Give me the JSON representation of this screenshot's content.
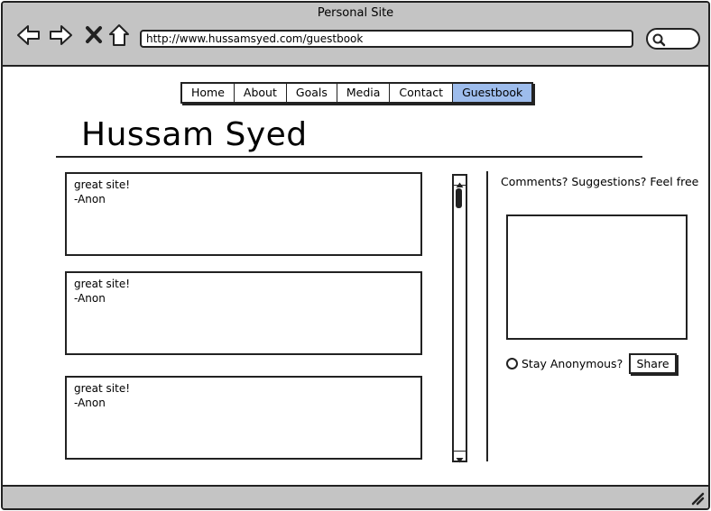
{
  "window": {
    "title": "Personal Site"
  },
  "browser": {
    "url": "http://www.hussamsyed.com/guestbook",
    "icons": [
      "back-arrow-icon",
      "forward-arrow-icon",
      "close-x-icon",
      "home-icon",
      "search-icon",
      "resize-grip-icon"
    ]
  },
  "nav": {
    "items": [
      {
        "label": "Home"
      },
      {
        "label": "About"
      },
      {
        "label": "Goals"
      },
      {
        "label": "Media"
      },
      {
        "label": "Contact"
      },
      {
        "label": "Guestbook",
        "active": true
      }
    ],
    "active_color": "#9dbcec"
  },
  "page": {
    "title": "Hussam Syed"
  },
  "comments": [
    {
      "text": "great site!",
      "author": "-Anon"
    },
    {
      "text": "great site!",
      "author": "-Anon"
    },
    {
      "text": "great site!",
      "author": "-Anon"
    }
  ],
  "sidebar": {
    "prompt": "Comments? Suggestions? Feel free",
    "comment_box_value": "",
    "anonymous_label": "Stay Anonymous?",
    "anonymous_checked": false,
    "share_label": "Share"
  },
  "colors": {
    "chrome": "#c4c4c4",
    "stroke": "#222222"
  }
}
